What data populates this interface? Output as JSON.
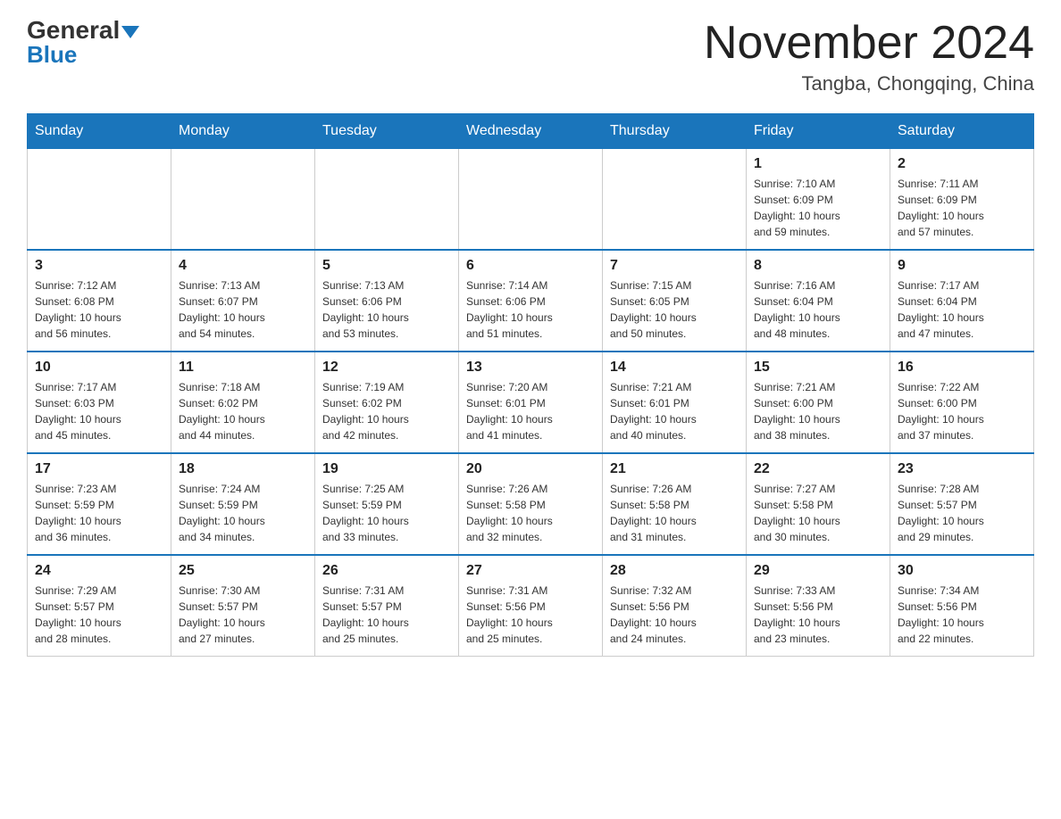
{
  "header": {
    "logo_general": "General",
    "logo_blue": "Blue",
    "month_title": "November 2024",
    "location": "Tangba, Chongqing, China"
  },
  "weekdays": [
    "Sunday",
    "Monday",
    "Tuesday",
    "Wednesday",
    "Thursday",
    "Friday",
    "Saturday"
  ],
  "weeks": [
    [
      {
        "day": "",
        "info": ""
      },
      {
        "day": "",
        "info": ""
      },
      {
        "day": "",
        "info": ""
      },
      {
        "day": "",
        "info": ""
      },
      {
        "day": "",
        "info": ""
      },
      {
        "day": "1",
        "info": "Sunrise: 7:10 AM\nSunset: 6:09 PM\nDaylight: 10 hours\nand 59 minutes."
      },
      {
        "day": "2",
        "info": "Sunrise: 7:11 AM\nSunset: 6:09 PM\nDaylight: 10 hours\nand 57 minutes."
      }
    ],
    [
      {
        "day": "3",
        "info": "Sunrise: 7:12 AM\nSunset: 6:08 PM\nDaylight: 10 hours\nand 56 minutes."
      },
      {
        "day": "4",
        "info": "Sunrise: 7:13 AM\nSunset: 6:07 PM\nDaylight: 10 hours\nand 54 minutes."
      },
      {
        "day": "5",
        "info": "Sunrise: 7:13 AM\nSunset: 6:06 PM\nDaylight: 10 hours\nand 53 minutes."
      },
      {
        "day": "6",
        "info": "Sunrise: 7:14 AM\nSunset: 6:06 PM\nDaylight: 10 hours\nand 51 minutes."
      },
      {
        "day": "7",
        "info": "Sunrise: 7:15 AM\nSunset: 6:05 PM\nDaylight: 10 hours\nand 50 minutes."
      },
      {
        "day": "8",
        "info": "Sunrise: 7:16 AM\nSunset: 6:04 PM\nDaylight: 10 hours\nand 48 minutes."
      },
      {
        "day": "9",
        "info": "Sunrise: 7:17 AM\nSunset: 6:04 PM\nDaylight: 10 hours\nand 47 minutes."
      }
    ],
    [
      {
        "day": "10",
        "info": "Sunrise: 7:17 AM\nSunset: 6:03 PM\nDaylight: 10 hours\nand 45 minutes."
      },
      {
        "day": "11",
        "info": "Sunrise: 7:18 AM\nSunset: 6:02 PM\nDaylight: 10 hours\nand 44 minutes."
      },
      {
        "day": "12",
        "info": "Sunrise: 7:19 AM\nSunset: 6:02 PM\nDaylight: 10 hours\nand 42 minutes."
      },
      {
        "day": "13",
        "info": "Sunrise: 7:20 AM\nSunset: 6:01 PM\nDaylight: 10 hours\nand 41 minutes."
      },
      {
        "day": "14",
        "info": "Sunrise: 7:21 AM\nSunset: 6:01 PM\nDaylight: 10 hours\nand 40 minutes."
      },
      {
        "day": "15",
        "info": "Sunrise: 7:21 AM\nSunset: 6:00 PM\nDaylight: 10 hours\nand 38 minutes."
      },
      {
        "day": "16",
        "info": "Sunrise: 7:22 AM\nSunset: 6:00 PM\nDaylight: 10 hours\nand 37 minutes."
      }
    ],
    [
      {
        "day": "17",
        "info": "Sunrise: 7:23 AM\nSunset: 5:59 PM\nDaylight: 10 hours\nand 36 minutes."
      },
      {
        "day": "18",
        "info": "Sunrise: 7:24 AM\nSunset: 5:59 PM\nDaylight: 10 hours\nand 34 minutes."
      },
      {
        "day": "19",
        "info": "Sunrise: 7:25 AM\nSunset: 5:59 PM\nDaylight: 10 hours\nand 33 minutes."
      },
      {
        "day": "20",
        "info": "Sunrise: 7:26 AM\nSunset: 5:58 PM\nDaylight: 10 hours\nand 32 minutes."
      },
      {
        "day": "21",
        "info": "Sunrise: 7:26 AM\nSunset: 5:58 PM\nDaylight: 10 hours\nand 31 minutes."
      },
      {
        "day": "22",
        "info": "Sunrise: 7:27 AM\nSunset: 5:58 PM\nDaylight: 10 hours\nand 30 minutes."
      },
      {
        "day": "23",
        "info": "Sunrise: 7:28 AM\nSunset: 5:57 PM\nDaylight: 10 hours\nand 29 minutes."
      }
    ],
    [
      {
        "day": "24",
        "info": "Sunrise: 7:29 AM\nSunset: 5:57 PM\nDaylight: 10 hours\nand 28 minutes."
      },
      {
        "day": "25",
        "info": "Sunrise: 7:30 AM\nSunset: 5:57 PM\nDaylight: 10 hours\nand 27 minutes."
      },
      {
        "day": "26",
        "info": "Sunrise: 7:31 AM\nSunset: 5:57 PM\nDaylight: 10 hours\nand 25 minutes."
      },
      {
        "day": "27",
        "info": "Sunrise: 7:31 AM\nSunset: 5:56 PM\nDaylight: 10 hours\nand 25 minutes."
      },
      {
        "day": "28",
        "info": "Sunrise: 7:32 AM\nSunset: 5:56 PM\nDaylight: 10 hours\nand 24 minutes."
      },
      {
        "day": "29",
        "info": "Sunrise: 7:33 AM\nSunset: 5:56 PM\nDaylight: 10 hours\nand 23 minutes."
      },
      {
        "day": "30",
        "info": "Sunrise: 7:34 AM\nSunset: 5:56 PM\nDaylight: 10 hours\nand 22 minutes."
      }
    ]
  ]
}
